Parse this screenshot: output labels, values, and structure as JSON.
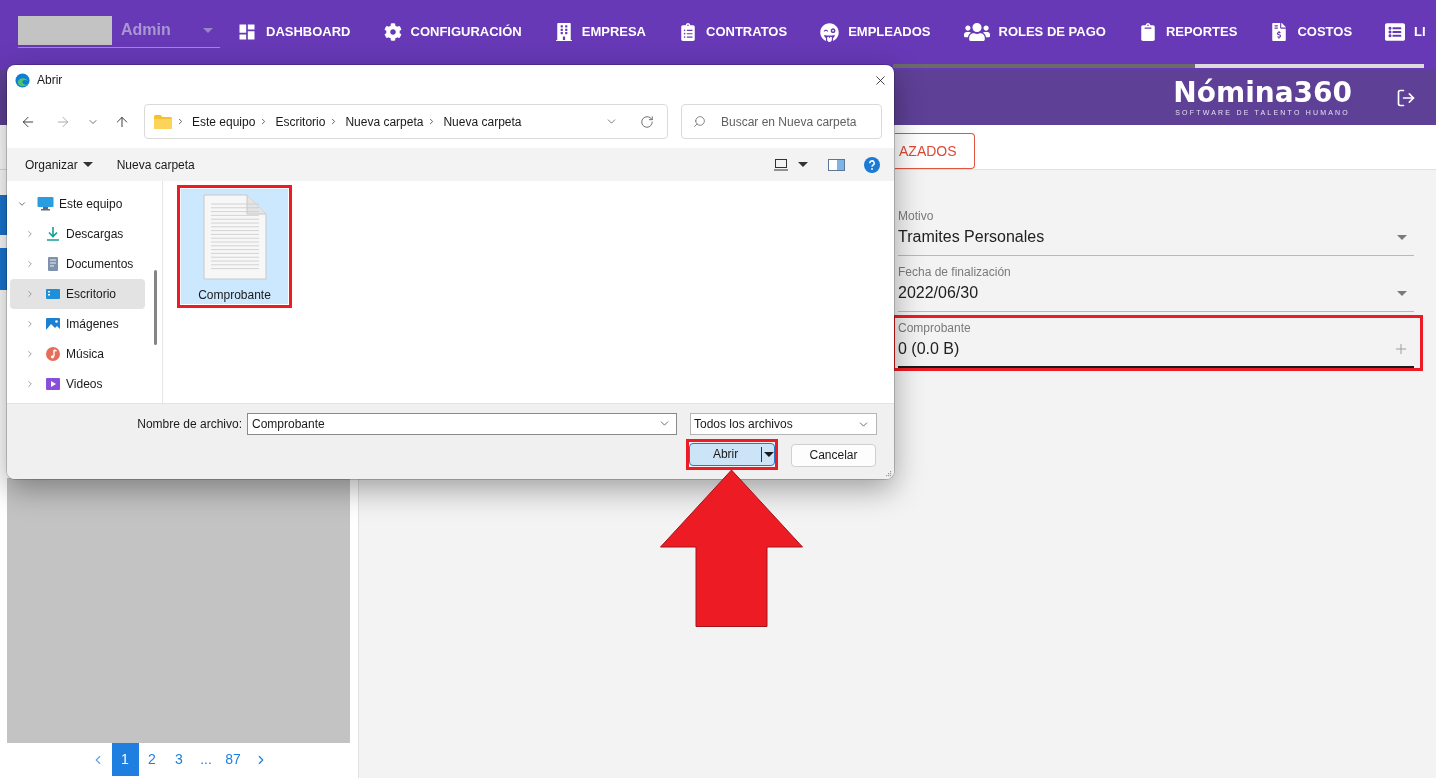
{
  "topnav": {
    "user": {
      "role": "Admin"
    },
    "items": [
      {
        "label": "DASHBOARD"
      },
      {
        "label": "CONFIGURACIÓN"
      },
      {
        "label": "EMPRESA"
      },
      {
        "label": "CONTRATOS"
      },
      {
        "label": "EMPLEADOS"
      },
      {
        "label": "ROLES DE PAGO"
      },
      {
        "label": "REPORTES"
      },
      {
        "label": "COSTOS"
      },
      {
        "label": "LI"
      }
    ]
  },
  "header": {
    "logo": {
      "name": "Nómina360",
      "tagline": "SOFTWARE DE TALENTO HUMANO"
    }
  },
  "toolbar": {
    "button": "AZADOS"
  },
  "sidebar": {
    "pagination": [
      {
        "label": "1",
        "selected": true
      },
      {
        "label": "2",
        "selected": false
      },
      {
        "label": "3",
        "selected": false
      },
      {
        "label": "...",
        "selected": false
      },
      {
        "label": "87",
        "selected": false
      }
    ]
  },
  "form": {
    "fields": [
      {
        "kind": "select",
        "label": "Motivo",
        "value": "Tramites Personales",
        "focused": false,
        "highlighted": false
      },
      {
        "kind": "select",
        "label": "Fecha de finalización",
        "value": "2022/06/30",
        "focused": false,
        "highlighted": false
      },
      {
        "kind": "file",
        "label": "Comprobante",
        "value": "0 (0.0 B)",
        "focused": true,
        "highlighted": true
      }
    ]
  },
  "dialog": {
    "title": "Abrir",
    "history_buttons": [
      {
        "kind": "back",
        "disabled": false
      },
      {
        "kind": "forward",
        "disabled": true
      },
      {
        "kind": "recent",
        "disabled": false
      },
      {
        "kind": "up",
        "disabled": false
      }
    ],
    "path": [
      "Este equipo",
      "Escritorio",
      "Nueva carpeta",
      "Nueva carpeta"
    ],
    "search": {
      "placeholder": "Buscar en Nueva carpeta"
    },
    "commands": [
      {
        "kind": "menu",
        "label": "Organizar"
      },
      {
        "kind": "plain",
        "label": "Nueva carpeta"
      }
    ],
    "nav_tree": [
      {
        "label": "Este equipo",
        "expanded": true,
        "selected": false,
        "children": [
          {
            "label": "Descargas",
            "expanded": false,
            "selected": false
          },
          {
            "label": "Documentos",
            "expanded": false,
            "selected": false
          },
          {
            "label": "Escritorio",
            "expanded": false,
            "selected": true
          },
          {
            "label": "Imágenes",
            "expanded": false,
            "selected": false
          },
          {
            "label": "Música",
            "expanded": false,
            "selected": false
          },
          {
            "label": "Videos",
            "expanded": false,
            "selected": false
          }
        ]
      }
    ],
    "files": [
      {
        "name": "Comprobante",
        "selected": true,
        "highlighted": true
      }
    ],
    "file_name": {
      "label": "Nombre de archivo:",
      "value": "Comprobante"
    },
    "file_type": {
      "value": "Todos los archivos"
    },
    "buttons": [
      {
        "kind": "split",
        "label": "Abrir",
        "highlighted": true
      },
      {
        "kind": "plain",
        "label": "Cancelar",
        "highlighted": false
      }
    ]
  },
  "pointer_arrow": true
}
